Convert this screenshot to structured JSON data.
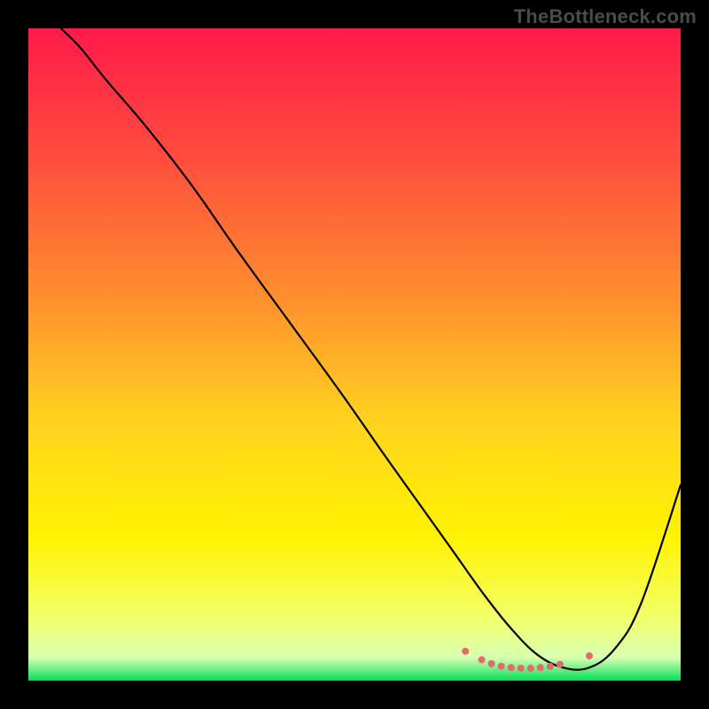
{
  "watermark": "TheBottleneck.com",
  "chart_data": {
    "type": "line",
    "title": "",
    "xlabel": "",
    "ylabel": "",
    "xlim": [
      0,
      100
    ],
    "ylim": [
      0,
      100
    ],
    "grid": false,
    "legend": false,
    "background": {
      "type": "vertical-gradient",
      "stops": [
        {
          "pos": 0.0,
          "color": "#ff1a4a"
        },
        {
          "pos": 0.2,
          "color": "#ff4d3d"
        },
        {
          "pos": 0.4,
          "color": "#ff8b2e"
        },
        {
          "pos": 0.6,
          "color": "#ffd21f"
        },
        {
          "pos": 0.78,
          "color": "#fff300"
        },
        {
          "pos": 0.9,
          "color": "#f3ff66"
        },
        {
          "pos": 0.965,
          "color": "#d8ffb0"
        },
        {
          "pos": 1.0,
          "color": "#00e05a"
        }
      ]
    },
    "series": [
      {
        "name": "curve",
        "color": "#000000",
        "width": 2.2,
        "x": [
          5,
          8,
          12,
          18,
          25,
          32,
          40,
          48,
          55,
          60,
          65,
          70,
          74,
          78,
          82,
          86,
          90,
          94,
          100
        ],
        "y": [
          100,
          97,
          92,
          85,
          76,
          66,
          55,
          44,
          34,
          27,
          20,
          13,
          8,
          4,
          2,
          2,
          5,
          12,
          30
        ]
      }
    ],
    "markers": {
      "name": "bottom-cluster",
      "color": "#e36a6a",
      "radius": 4,
      "x": [
        67,
        69.5,
        71,
        72.5,
        74,
        75.5,
        77,
        78.5,
        80,
        81.5,
        86
      ],
      "y": [
        4.5,
        3.2,
        2.6,
        2.2,
        2.0,
        1.9,
        1.9,
        2.0,
        2.2,
        2.5,
        3.8
      ]
    }
  }
}
